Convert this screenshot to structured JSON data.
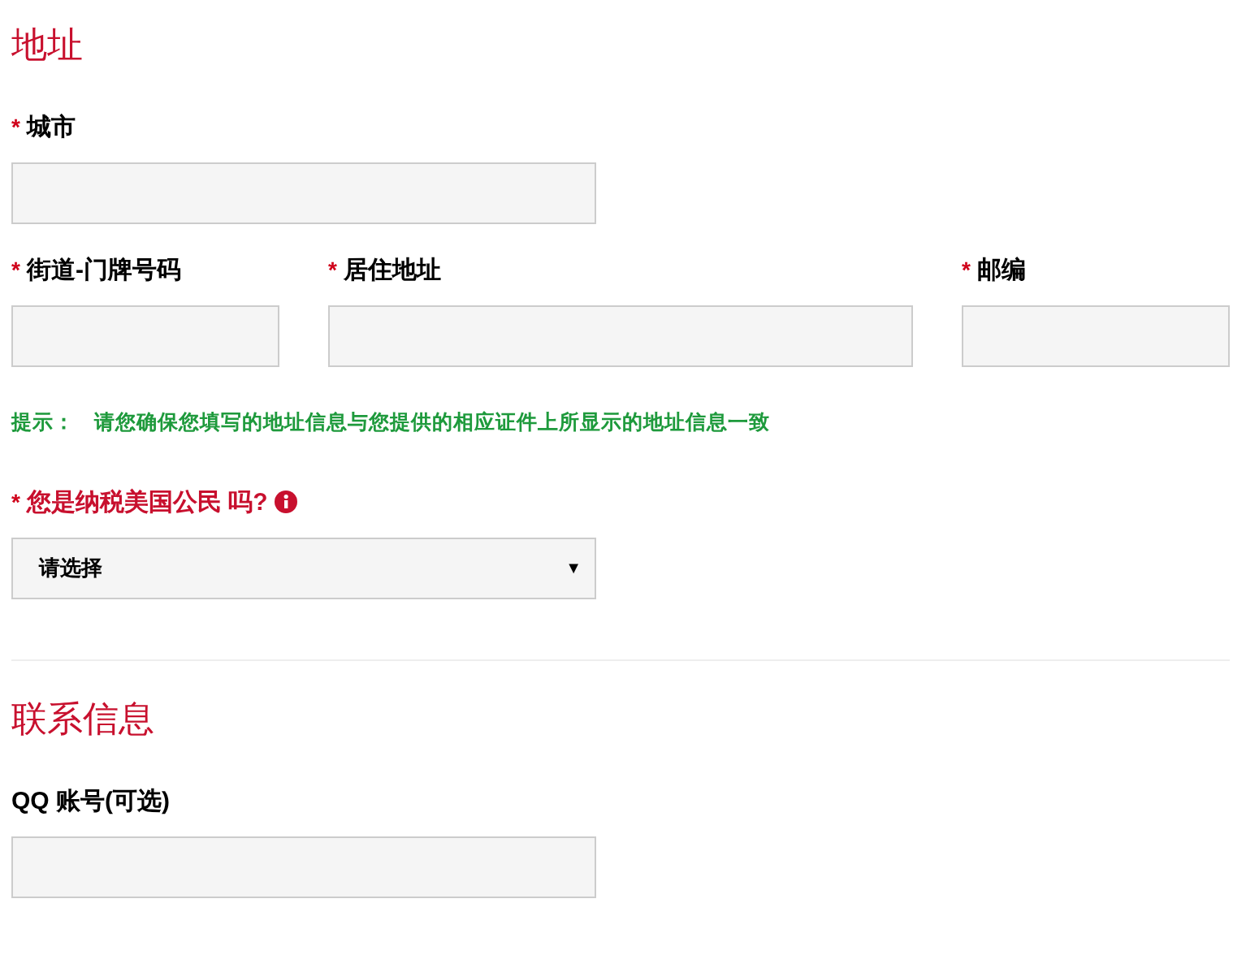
{
  "sections": [
    {
      "heading": "地址",
      "blocks": [
        {
          "kind": "fields",
          "fields": [
            {
              "asterisk": "*",
              "label": "城市",
              "kind": "text"
            }
          ]
        },
        {
          "kind": "fields",
          "fields": [
            {
              "asterisk": "*",
              "label": "街道-门牌号码",
              "kind": "text"
            },
            {
              "asterisk": "*",
              "label": "居住地址",
              "kind": "text"
            },
            {
              "asterisk": "*",
              "label": "邮编",
              "kind": "text"
            }
          ]
        },
        {
          "kind": "hint",
          "label": "提示：",
          "text": "请您确保您填写的地址信息与您提供的相应证件上所显示的地址信息一致"
        },
        {
          "kind": "fields",
          "fields": [
            {
              "asterisk": "*",
              "label": "您是纳税美国公民 吗?",
              "kind": "select",
              "warning": true,
              "info_icon": true,
              "value": "请选择",
              "caret": "▼"
            }
          ]
        }
      ]
    },
    {
      "heading": "联系信息",
      "blocks": [
        {
          "kind": "fields",
          "fields": [
            {
              "label": "QQ 账号(可选)",
              "kind": "text"
            }
          ]
        }
      ]
    }
  ]
}
